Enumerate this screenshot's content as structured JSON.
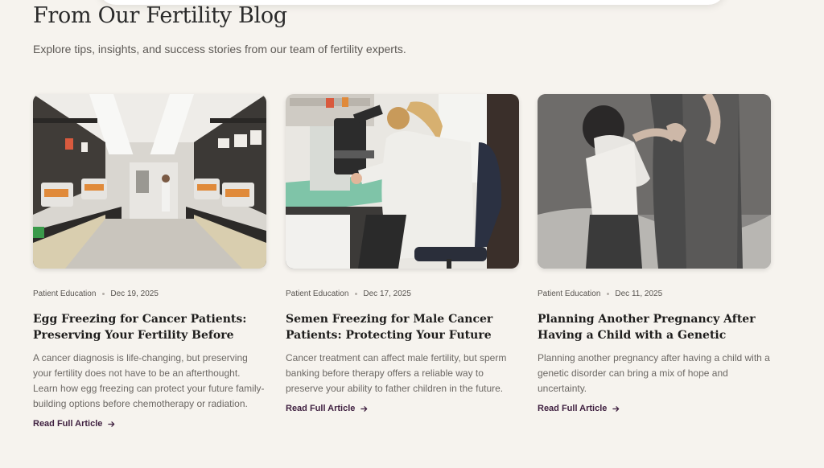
{
  "blog": {
    "title": "From Our Fertility Blog",
    "subtitle": "Explore tips, insights, and success stories from our team of fertility experts.",
    "posts": [
      {
        "image_subject": "fertility lab with equipment and technician",
        "category": "Patient Education",
        "date": "Dec 19, 2025",
        "title": "Egg Freezing for Cancer Patients: Preserving Your Fertility Before Treatment",
        "excerpt": "A cancer diagnosis is life-changing, but preserving your fertility does not have to be an afterthought. Learn how egg freezing can protect your future family-building options before chemotherapy or radiation.",
        "cta": "Read Full Article"
      },
      {
        "image_subject": "scientist using a microscope",
        "category": "Patient Education",
        "date": "Dec 17, 2025",
        "title": "Semen Freezing for Male Cancer Patients: Protecting Your Future Fertility",
        "excerpt": "Cancer treatment can affect male fertility, but sperm banking before therapy offers a reliable way to preserve your ability to father children in the future.",
        "cta": "Read Full Article"
      },
      {
        "image_subject": "child hugging a parent's legs",
        "category": "Patient Education",
        "date": "Dec 11, 2025",
        "title": "Planning Another Pregnancy After Having a Child with a Genetic Disorder",
        "excerpt": "Planning another pregnancy after having a child with a genetic disorder can bring a mix of hope and uncertainty.",
        "cta": "Read Full Article"
      }
    ]
  },
  "colors": {
    "background": "#f6f3ee",
    "heading": "#2a2a2a",
    "body_text": "#6c6864",
    "link": "#3e1f3f"
  }
}
